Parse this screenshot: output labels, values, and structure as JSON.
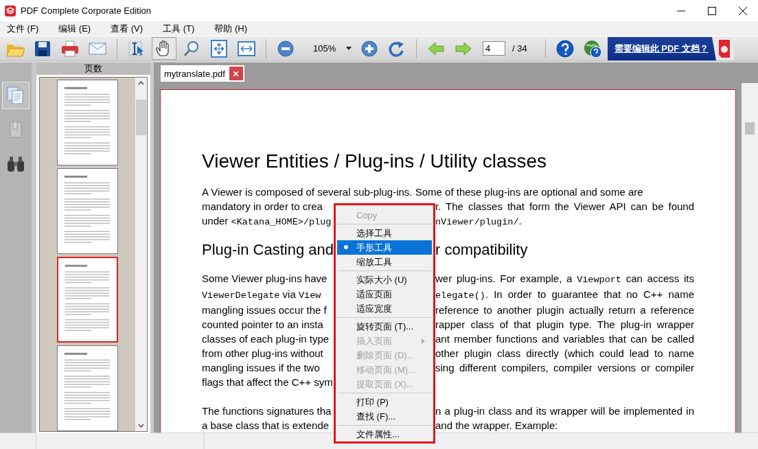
{
  "window": {
    "title": "PDF Complete Corporate Edition"
  },
  "menu_bar": [
    "文件 (F)",
    "编辑 (E)",
    "查看 (V)",
    "工具 (T)",
    "帮助 (H)"
  ],
  "toolbar": [
    {
      "kind": "open",
      "pressed": false
    },
    {
      "kind": "save",
      "pressed": false
    },
    {
      "kind": "print",
      "pressed": false
    },
    {
      "kind": "mail",
      "pressed": false
    },
    {
      "kind": "separator"
    },
    {
      "kind": "select",
      "pressed": false
    },
    {
      "kind": "hand",
      "pressed": true
    },
    {
      "kind": "zoom",
      "pressed": false
    },
    {
      "kind": "fit-page",
      "pressed": false
    },
    {
      "kind": "fit-width",
      "pressed": false
    },
    {
      "kind": "separator"
    },
    {
      "kind": "zoom-out",
      "pressed": false
    },
    {
      "kind": "zoom-level",
      "text": "105%"
    },
    {
      "kind": "zoom-in",
      "pressed": false
    },
    {
      "kind": "rotate",
      "pressed": false
    },
    {
      "kind": "separator"
    },
    {
      "kind": "back",
      "pressed": false
    },
    {
      "kind": "forward",
      "pressed": false
    },
    {
      "kind": "page",
      "value": "4",
      "total": "/ 34"
    },
    {
      "kind": "separator"
    },
    {
      "kind": "help",
      "pressed": false
    },
    {
      "kind": "web-help",
      "pressed": false
    },
    {
      "kind": "banner",
      "text": "需要编辑此 PDF 文档？"
    }
  ],
  "side_rail": [
    {
      "kind": "pages",
      "selected": true
    },
    {
      "kind": "bookmarks",
      "selected": false
    },
    {
      "kind": "search",
      "selected": false
    }
  ],
  "pages_panel": {
    "title": "页数",
    "thumbnails": [
      {
        "selected": false
      },
      {
        "selected": false
      },
      {
        "selected": true
      },
      {
        "selected": false
      }
    ]
  },
  "tabs": [
    {
      "label": "mytranslate.pdf",
      "selected": true
    }
  ],
  "document": {
    "blocks": [
      {
        "kind": "heading",
        "left": [
          "Viewer Entities / Plug-ins / Utility classes"
        ]
      },
      {
        "kind": "line",
        "left": [
          "A Viewer is composed of several sub-plug-ins. Some of these plug-ins are optional and some are"
        ]
      },
      {
        "kind": "line",
        "left": [
          "mandatory in order to crea"
        ],
        "right": [
          "r. The classes that form the Viewer API can be found"
        ]
      },
      {
        "kind": "last-line",
        "left": [
          "under ",
          {
            "text": "<Katana_HOME>/plug",
            "code": true
          }
        ],
        "right": [
          {
            "text": "nViewer/plugin/",
            "code": true
          },
          "."
        ]
      },
      {
        "kind": "subheading",
        "left": [
          "Plug-in Casting and"
        ],
        "right": [
          "r compatibility"
        ]
      },
      {
        "kind": "line",
        "left": [
          "Some Viewer plug-ins have"
        ],
        "right": [
          "wer plug-ins. For example, a ",
          {
            "text": "Viewport",
            "code": true
          },
          " can access its"
        ]
      },
      {
        "kind": "line",
        "left": [
          {
            "text": "ViewerDelegate",
            "code": true
          },
          " via ",
          {
            "text": "View",
            "code": true
          }
        ],
        "right": [
          {
            "text": "elegate()",
            "code": true
          },
          ". In order to guarantee that no C++ name"
        ]
      },
      {
        "kind": "line",
        "left": [
          "mangling issues occur the f"
        ],
        "right": [
          "reference to another plugin actually return a reference"
        ]
      },
      {
        "kind": "line",
        "left": [
          "counted pointer to an insta"
        ],
        "right": [
          "rapper class of that plugin type. The plug-in wrapper"
        ]
      },
      {
        "kind": "line",
        "left": [
          "classes of each plug-in type"
        ],
        "right": [
          "ant member functions and variables that can be called"
        ]
      },
      {
        "kind": "line",
        "left": [
          "from other plug-ins without"
        ],
        "right": [
          "other plugin class directly (which could lead to name"
        ]
      },
      {
        "kind": "line",
        "left": [
          "mangling issues if the two"
        ],
        "right": [
          "sing different compilers, compiler versions or compiler"
        ]
      },
      {
        "kind": "last-line",
        "left": [
          "flags that affect the C++ sym"
        ]
      },
      {
        "kind": "gap"
      },
      {
        "kind": "line",
        "left": [
          "The functions signatures tha"
        ],
        "right": [
          "n a plug-in class and its wrapper will be implemented in"
        ]
      },
      {
        "kind": "last-line",
        "left": [
          "a base class that is extende"
        ],
        "right": [
          "and the wrapper. Example:"
        ]
      }
    ]
  },
  "context_menu": [
    {
      "kind": "item",
      "label": "Copy",
      "disabled": true,
      "selected": false,
      "submenu": false
    },
    {
      "kind": "separator"
    },
    {
      "kind": "item",
      "label": "选择工具",
      "disabled": false,
      "selected": false,
      "submenu": false
    },
    {
      "kind": "item",
      "label": "手形工具",
      "disabled": false,
      "selected": true,
      "submenu": false
    },
    {
      "kind": "item",
      "label": "缩放工具",
      "disabled": false,
      "selected": false,
      "submenu": false
    },
    {
      "kind": "separator"
    },
    {
      "kind": "item",
      "label": "实际大小 (U)",
      "disabled": false,
      "selected": false,
      "submenu": false
    },
    {
      "kind": "item",
      "label": "适应页面",
      "disabled": false,
      "selected": false,
      "submenu": false
    },
    {
      "kind": "item",
      "label": "适应宽度",
      "disabled": false,
      "selected": false,
      "submenu": false
    },
    {
      "kind": "separator"
    },
    {
      "kind": "item",
      "label": "旋转页面 (T)...",
      "disabled": false,
      "selected": false,
      "submenu": false
    },
    {
      "kind": "item",
      "label": "插入页面",
      "disabled": true,
      "selected": false,
      "submenu": true
    },
    {
      "kind": "item",
      "label": "删除页面 (D)...",
      "disabled": true,
      "selected": false,
      "submenu": false
    },
    {
      "kind": "item",
      "label": "移动页面 (M)...",
      "disabled": true,
      "selected": false,
      "submenu": false
    },
    {
      "kind": "item",
      "label": "提取页面 (X)...",
      "disabled": true,
      "selected": false,
      "submenu": false
    },
    {
      "kind": "separator"
    },
    {
      "kind": "item",
      "label": "打印 (P)",
      "disabled": false,
      "selected": false,
      "submenu": false
    },
    {
      "kind": "item",
      "label": "查找 (F)...",
      "disabled": false,
      "selected": false,
      "submenu": false
    },
    {
      "kind": "separator"
    },
    {
      "kind": "item",
      "label": "文件属性...",
      "disabled": false,
      "selected": false,
      "submenu": false
    }
  ]
}
